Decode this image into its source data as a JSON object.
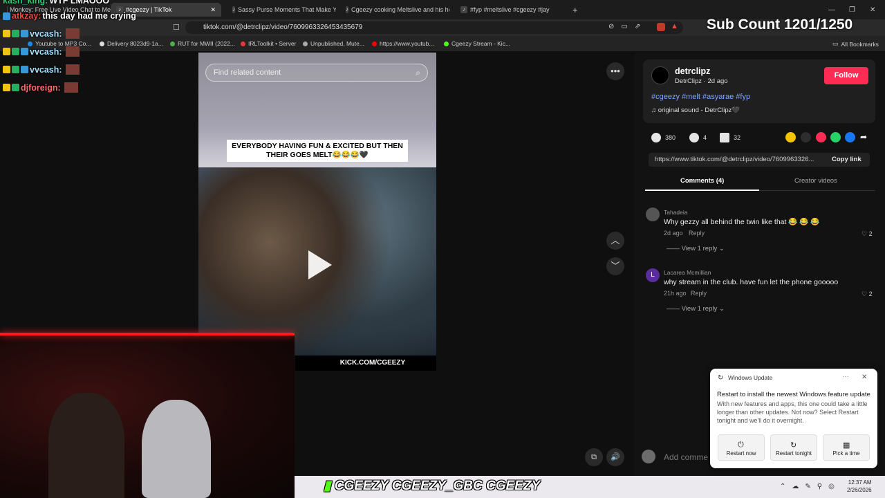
{
  "browser": {
    "tabs": [
      {
        "label": "Monkey: Free Live Video Chat to Me"
      },
      {
        "label": "#cgeezy | TikTok"
      },
      {
        "label": "Sassy Purse Moments That Make You"
      },
      {
        "label": "Cgeezy cooking Meltslive and his ho"
      },
      {
        "label": "#fyp #meltslive #cgeezy #jay"
      }
    ],
    "new_tab": "+",
    "url": "tiktok.com/@detrclipz/video/7609963326453435679",
    "bookmarks": [
      {
        "label": "Youtube to MP3 Co..."
      },
      {
        "label": "Delivery 8023d9-1a..."
      },
      {
        "label": "RUT for MWII (2022..."
      },
      {
        "label": "IRLToolkit • Server"
      },
      {
        "label": "Unpublished, Mute..."
      },
      {
        "label": "https://www.youtub..."
      },
      {
        "label": "Cgeezy Stream - Kic..."
      }
    ],
    "all_bookmarks": "All Bookmarks"
  },
  "video": {
    "search_placeholder": "Find related content",
    "caption": "EVERYBODY HAVING FUN & EXCITED BUT THEN THEIR GOES MELT😂😂😂🖤",
    "kick_label": "KICK.COM/CGEEZY"
  },
  "post": {
    "author_handle": "detrclipz",
    "author_name": "DetrClipz",
    "posted": "· 2d ago",
    "follow": "Follow",
    "hashtags": "#cgeezy #melt #asyarae #fyp",
    "sound": "♫  original sound - DetrClipz🖤",
    "likes": "380",
    "comments": "4",
    "saves": "32",
    "link": "https://www.tiktok.com/@detrclipz/video/7609963326...",
    "copy_link": "Copy link",
    "tab_comments": "Comments (4)",
    "tab_creator": "Creator videos",
    "add_comment": "Add comme"
  },
  "comments": [
    {
      "name": "Tahadeia",
      "text": "Why gezzy all behind the twin like that 😂 😂 😂",
      "time": "2d ago",
      "reply": "Reply",
      "likes": "2",
      "view_reply": "View 1 reply"
    },
    {
      "name": "Lacarea Mcmillian",
      "text": "why stream in the club. have fun let the phone gooooo",
      "time": "21h ago",
      "reply": "Reply",
      "likes": "2",
      "view_reply": "View 1 reply",
      "initial": "L"
    }
  ],
  "stream": {
    "chat": [
      {
        "user": "kash_king:",
        "msg": "WTF LMAOOO"
      },
      {
        "user": "atkzay:",
        "msg": "this day had me crying"
      },
      {
        "user": "vvcash:",
        "msg": ""
      },
      {
        "user": "vvcash:",
        "msg": ""
      },
      {
        "user": "vvcash:",
        "msg": ""
      },
      {
        "user": "djforeign:",
        "msg": ""
      }
    ],
    "sub_count": "Sub Count 1201/1250",
    "socials": "CGEEZY  CGEEZY_GBC  CGEEZY"
  },
  "notification": {
    "app": "Windows Update",
    "title": "Restart to install the newest Windows feature update",
    "body": "With new features and apps, this one could take a little longer than other updates. Not now? Select Restart tonight and we'll do it overnight.",
    "btn_now": "Restart now",
    "btn_tonight": "Restart tonight",
    "btn_pick": "Pick a time"
  },
  "taskbar": {
    "time": "12:37 AM",
    "date": "2/26/2026"
  },
  "colors": {
    "accent": "#fe2c55",
    "hashtag": "#7ea6ff"
  }
}
